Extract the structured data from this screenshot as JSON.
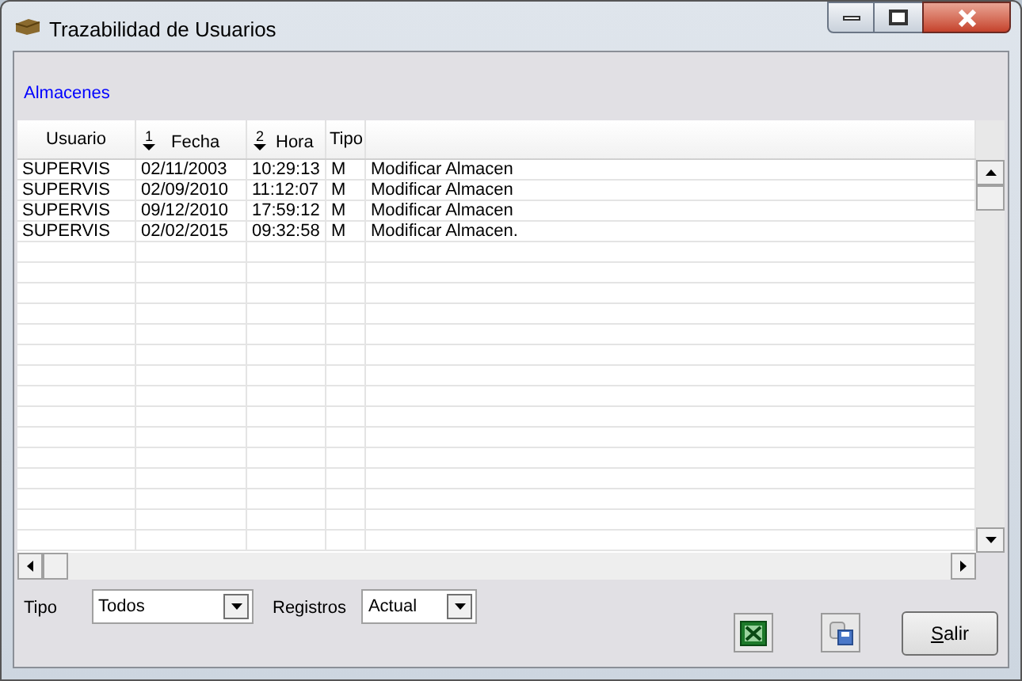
{
  "window": {
    "title": "Trazabilidad de Usuarios"
  },
  "section_link": "Almacenes",
  "table": {
    "columns": [
      {
        "label": "Usuario"
      },
      {
        "label": "Fecha",
        "sort_index": "1"
      },
      {
        "label": "Hora",
        "sort_index": "2"
      },
      {
        "label": "Tipo"
      }
    ],
    "rows": [
      [
        "SUPERVIS",
        "02/11/2003",
        "10:29:13",
        "M",
        "Modificar Almacen"
      ],
      [
        "SUPERVIS",
        "02/09/2010",
        "11:12:07",
        "M",
        "Modificar Almacen"
      ],
      [
        "SUPERVIS",
        "09/12/2010",
        "17:59:12",
        "M",
        "Modificar Almacen"
      ],
      [
        "SUPERVIS",
        "02/02/2015",
        "09:32:58",
        "M",
        "Modificar Almacen."
      ]
    ]
  },
  "filters": [
    {
      "label": "Tipo",
      "value": "Todos"
    },
    {
      "label": "Registros",
      "value": "Actual"
    }
  ],
  "buttons": [
    {
      "kind": "excel"
    },
    {
      "kind": "save"
    },
    {
      "kind": "text",
      "label": "Salir",
      "mnemonic": true
    }
  ]
}
